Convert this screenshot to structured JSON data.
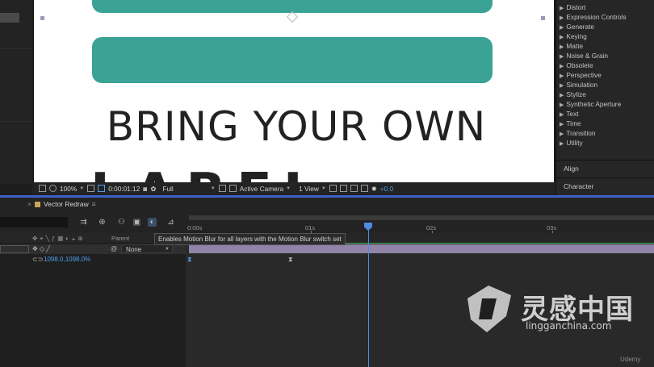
{
  "composition": {
    "headline": "BRING YOUR OWN",
    "partial_text": "LABEL"
  },
  "effects_panel": {
    "categories": [
      "Distort",
      "Expression Controls",
      "Generate",
      "Keying",
      "Matte",
      "Noise & Grain",
      "Obsolete",
      "Perspective",
      "Simulation",
      "Stylize",
      "Synthetic Aperture",
      "Text",
      "Time",
      "Transition",
      "Utility"
    ],
    "align_tab": "Align",
    "character_tab": "Character"
  },
  "viewer_toolbar": {
    "zoom": "100%",
    "timecode": "0:00:01:12",
    "resolution": "Full",
    "camera": "Active Camera",
    "view": "1 View",
    "exposure": "+0.0"
  },
  "timeline": {
    "tab_label": "Vector Redraw",
    "tooltip": "Enables Motion Blur for all layers with the Motion Blur switch set",
    "parent_header": "Parent",
    "parent_value": "None",
    "scale_value": "1098.0,1098.0%",
    "ruler_labels": [
      "0:00s",
      "01s",
      "02s",
      "03s"
    ],
    "accent": "#4d8ce0"
  },
  "watermark": {
    "main": "灵感中国",
    "sub": "lingganchina.com"
  },
  "udemy": "Udemy"
}
